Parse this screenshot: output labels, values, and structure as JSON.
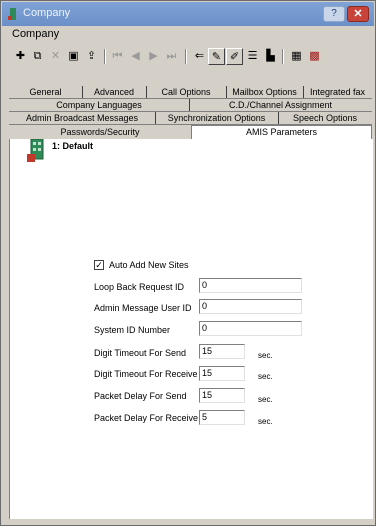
{
  "window": {
    "title": "Company",
    "help_glyph": "?",
    "close_glyph": "✕"
  },
  "menu": {
    "items": [
      "Company"
    ]
  },
  "toolbar": {
    "buttons": [
      {
        "icon": "add-icon",
        "glyph": "✚"
      },
      {
        "icon": "copy-icon",
        "glyph": "⧉"
      },
      {
        "icon": "delete-icon",
        "glyph": "✕"
      },
      {
        "icon": "save-icon",
        "glyph": "▣"
      },
      {
        "icon": "export-icon",
        "glyph": "⇪"
      },
      {
        "icon": "first-record-icon",
        "glyph": "⏮"
      },
      {
        "icon": "previous-record-icon",
        "glyph": "◀"
      },
      {
        "icon": "next-record-icon",
        "glyph": "▶"
      },
      {
        "icon": "last-record-icon",
        "glyph": "⏭"
      },
      {
        "icon": "undo-icon",
        "glyph": "⇐"
      },
      {
        "icon": "wizard-icon",
        "glyph": "✎"
      },
      {
        "icon": "edit-icon",
        "glyph": "✐"
      },
      {
        "icon": "properties-icon",
        "glyph": "☰"
      },
      {
        "icon": "chart-icon",
        "glyph": "▙"
      },
      {
        "icon": "report-icon",
        "glyph": "▦"
      },
      {
        "icon": "grid-icon",
        "glyph": "▩"
      }
    ]
  },
  "tabs": {
    "row1": [
      "General",
      "Advanced",
      "Call Options",
      "Mailbox Options",
      "Integrated fax"
    ],
    "row2": [
      "Company Languages",
      "C.D./Channel Assignment"
    ],
    "row3": [
      "Admin Broadcast Messages",
      "Synchronization Options",
      "Speech Options"
    ],
    "row4": [
      "Passwords/Security",
      "AMIS Parameters"
    ],
    "active": "AMIS Parameters"
  },
  "site": {
    "label": "1: Default"
  },
  "form": {
    "auto_add_label": "Auto Add New Sites",
    "auto_add_checked": true,
    "fields": [
      {
        "label": "Loop Back Request ID",
        "value": "0"
      },
      {
        "label": "Admin Message User ID",
        "value": "0"
      },
      {
        "label": "System ID Number",
        "value": "0"
      },
      {
        "label": "Digit Timeout For Send",
        "value": "15",
        "unit": "sec."
      },
      {
        "label": "Digit Timeout For Receive",
        "value": "15",
        "unit": "sec."
      },
      {
        "label": "Packet Delay For Send",
        "value": "15",
        "unit": "sec."
      },
      {
        "label": "Packet Delay For Receive",
        "value": "5",
        "unit": "sec."
      }
    ]
  },
  "colors": {
    "title_bar": "#7fa3d6",
    "close_button": "#c8443a",
    "dialog_face": "#d4d0c8"
  }
}
